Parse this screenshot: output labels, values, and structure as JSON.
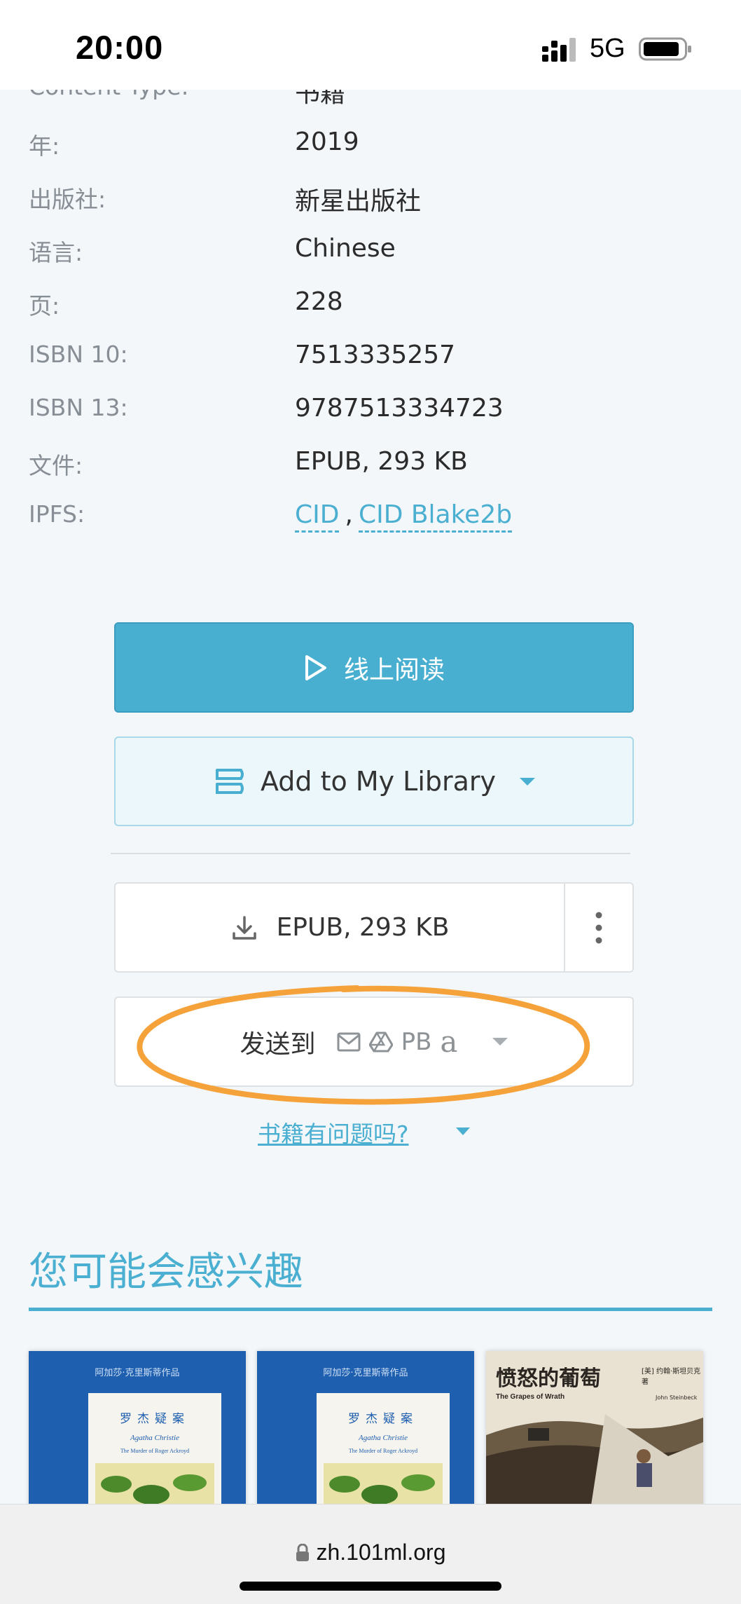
{
  "status_bar": {
    "time": "20:00",
    "network": "5G",
    "icons": [
      "signal-icon",
      "battery-icon"
    ]
  },
  "details": {
    "partial_row": {
      "label": "Content Type:",
      "value": "书籍"
    },
    "rows": [
      {
        "label": "年:",
        "value": "2019"
      },
      {
        "label": "出版社:",
        "value": "新星出版社"
      },
      {
        "label": "语言:",
        "value": "Chinese"
      },
      {
        "label": "页:",
        "value": "228"
      },
      {
        "label": "ISBN 10:",
        "value": "7513335257"
      },
      {
        "label": "ISBN 13:",
        "value": "9787513334723"
      },
      {
        "label": "文件:",
        "value": "EPUB, 293 KB"
      }
    ],
    "ipfs": {
      "label": "IPFS:",
      "links": [
        "CID",
        "CID Blake2b"
      ],
      "separator": ","
    }
  },
  "actions": {
    "read_online": "线上阅读",
    "add_to_library": "Add to My Library",
    "download": "EPUB, 293 KB",
    "send_to": "发送到",
    "send_targets": [
      "email-icon",
      "google-drive-icon",
      "PB",
      "a"
    ],
    "problem_link": "书籍有问题吗?"
  },
  "recommendations": {
    "title": "您可能会感兴趣",
    "books": [
      {
        "series": "阿加莎·克里斯蒂作品",
        "title": "罗杰疑案",
        "author_en": "Agatha Christie",
        "subtitle": "The Murder of Roger Ackroyd"
      },
      {
        "series": "阿加莎·克里斯蒂作品",
        "title": "罗杰疑案",
        "author_en": "Agatha Christie",
        "subtitle": "The Murder of Roger Ackroyd"
      },
      {
        "title": "愤怒的葡萄",
        "subtitle": "The Grapes of Wrath",
        "author": "[美] 约翰·斯坦贝克 著",
        "author_en": "John Steinbeck"
      }
    ]
  },
  "browser": {
    "url": "zh.101ml.org"
  },
  "colors": {
    "accent": "#49afd1",
    "annotation": "#f5a23a",
    "background": "#f3f7fa"
  }
}
